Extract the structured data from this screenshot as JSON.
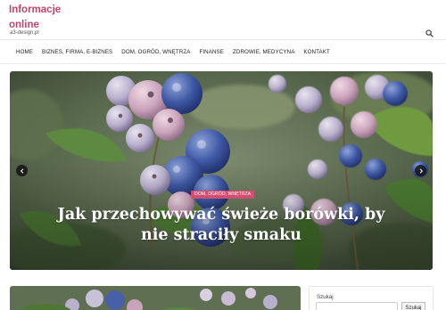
{
  "site": {
    "title": "Informacje online",
    "tagline": "a3-design.pl"
  },
  "header": {
    "search_icon": "search-icon"
  },
  "nav": {
    "items": [
      {
        "label": "HOME"
      },
      {
        "label": "BIZNES, FIRMA, E-BIZNES"
      },
      {
        "label": "DOM, OGRÓD, WNĘTRZA"
      },
      {
        "label": "FINANSE"
      },
      {
        "label": "ZDROWIE, MEDYCYNA"
      },
      {
        "label": "KONTAKT"
      }
    ]
  },
  "hero": {
    "category": "DOM, OGRÓD, WNĘTRZA",
    "title": "Jak przechowywać świeże borówki, by nie straciły smaku",
    "prev_icon": "chevron-left-icon",
    "next_icon": "chevron-right-icon",
    "accent_color": "#d14d72"
  },
  "sidebar": {
    "search_label": "Szukaj",
    "search_button": "Szukaj",
    "search_value": ""
  },
  "colors": {
    "brand": "#c2456b",
    "category_badge": "#d14d72"
  }
}
